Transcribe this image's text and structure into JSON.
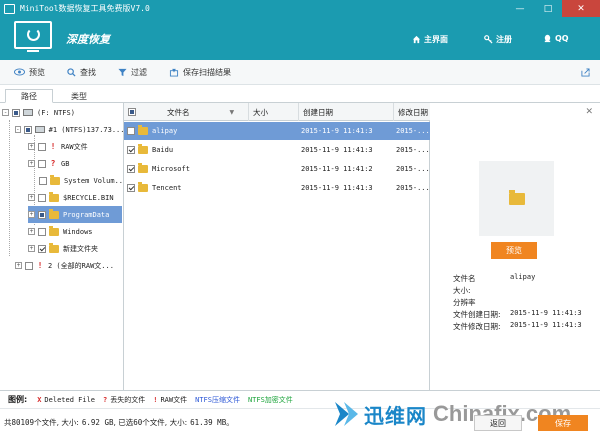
{
  "window": {
    "title": "MiniTool数据恢复工具免费版V7.0"
  },
  "header": {
    "mode_title": "深度恢复",
    "nav": [
      {
        "label": "主界面",
        "icon": "home-icon"
      },
      {
        "label": "注册",
        "icon": "key-icon"
      },
      {
        "label": "QQ",
        "icon": "qq-icon"
      }
    ]
  },
  "toolbar": {
    "items": [
      {
        "label": "预览",
        "icon": "eye-icon"
      },
      {
        "label": "查找",
        "icon": "search-icon"
      },
      {
        "label": "过滤",
        "icon": "filter-icon"
      },
      {
        "label": "保存扫描结果",
        "icon": "save-scan-icon"
      }
    ]
  },
  "tabs": [
    {
      "label": "路径",
      "active": true
    },
    {
      "label": "类型",
      "active": false
    }
  ],
  "tree": {
    "nodes": [
      {
        "label": "(F: NTFS)"
      },
      {
        "label": "#1 (NTFS)137.73..."
      },
      {
        "label": "RAW文件"
      },
      {
        "label": "GB"
      },
      {
        "label": "System Volum..."
      },
      {
        "label": "$RECYCLE.BIN"
      },
      {
        "label": "ProgramData"
      },
      {
        "label": "Windows"
      },
      {
        "label": "新建文件夹"
      },
      {
        "label": "2 (全部的RAW文..."
      }
    ]
  },
  "list": {
    "columns": [
      "文件名",
      "大小",
      "创建日期",
      "修改日期"
    ],
    "rows": [
      {
        "name": "alipay",
        "size": "",
        "created": "2015-11-9 11:41:3",
        "modified": "2015-..."
      },
      {
        "name": "Baidu",
        "size": "",
        "created": "2015-11-9 11:41:3",
        "modified": "2015-..."
      },
      {
        "name": "Microsoft",
        "size": "",
        "created": "2015-11-9 11:41:2",
        "modified": "2015-..."
      },
      {
        "name": "Tencent",
        "size": "",
        "created": "2015-11-9 11:41:3",
        "modified": "2015-..."
      }
    ]
  },
  "preview": {
    "button_label": "预览",
    "fields": [
      {
        "label": "文件名",
        "value": "alipay"
      },
      {
        "label": "大小:",
        "value": ""
      },
      {
        "label": "分辨率",
        "value": ""
      },
      {
        "label": "文件创建日期:",
        "value": "2015-11-9 11:41:3"
      },
      {
        "label": "文件修改日期:",
        "value": "2015-11-9 11:41:3"
      }
    ]
  },
  "legend": {
    "title": "图例:",
    "items": [
      {
        "mark": "X",
        "label": "Deleted File",
        "color": "#d62a2a"
      },
      {
        "mark": "?",
        "label": "丢失的文件",
        "color": "#d62a2a"
      },
      {
        "mark": "!",
        "label": "RAW文件",
        "color": "#d62a2a"
      },
      {
        "mark": "",
        "label": "NTFS压缩文件",
        "color": "#2a56d6"
      },
      {
        "mark": "",
        "label": "NTFS加密文件",
        "color": "#1aa33a"
      }
    ]
  },
  "status": {
    "total_prefix": "共",
    "total_count": "80109",
    "total_mid": "个文件, 大小:",
    "total_size": "6.92 GB",
    "sel_prefix": ", 已选",
    "sel_count": "60",
    "sel_mid": "个文件, 大小:",
    "sel_size": "61.39 MB",
    "sel_suffix": "。"
  },
  "buttons": {
    "back": "返回",
    "save": "保存"
  },
  "watermark": {
    "cn": "迅维网",
    "en": "Chinafix.com"
  },
  "colors": {
    "header": "#1b9bb0",
    "selection": "#6f9bd6",
    "accent": "#f08520"
  }
}
